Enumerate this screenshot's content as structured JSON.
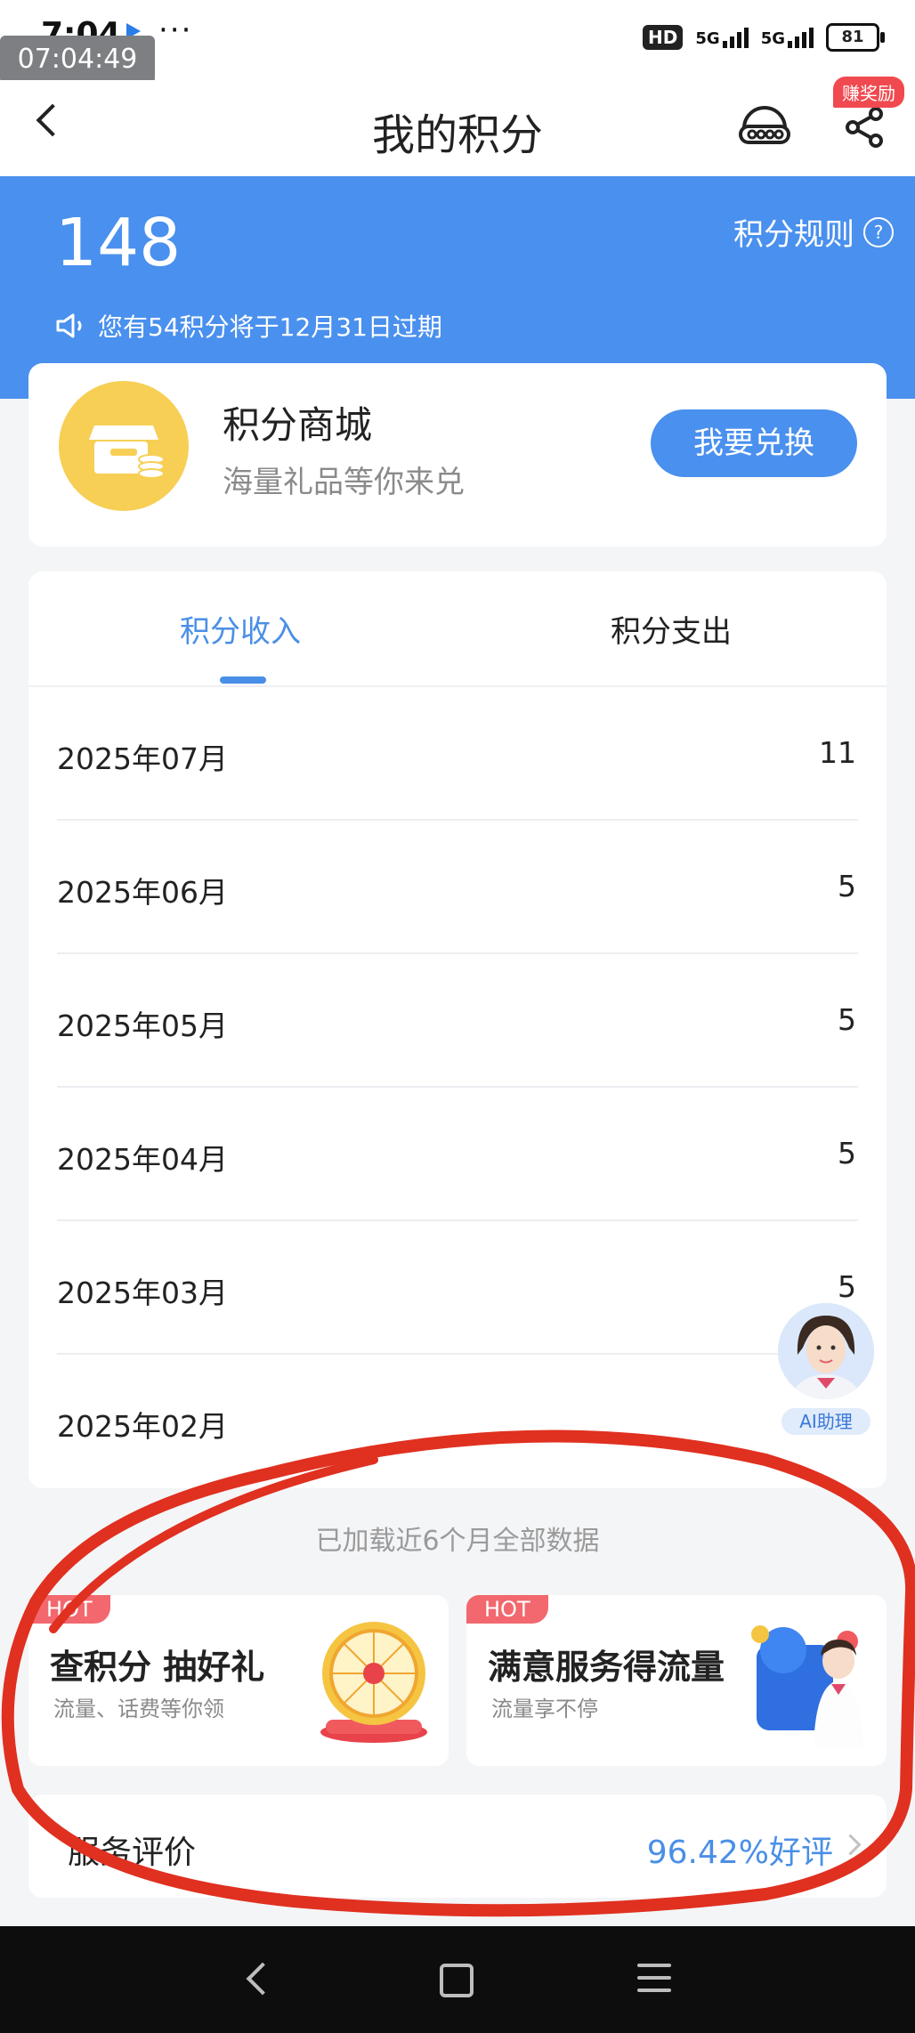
{
  "status_bar": {
    "time": "7:04",
    "dots": "···",
    "clock_badge": "07:04:49",
    "hd": "HD",
    "net1": "5G",
    "net2": "5G",
    "battery": "81"
  },
  "navbar": {
    "title": "我的积分",
    "reward_badge": "赚奖励"
  },
  "hero": {
    "points": "148",
    "rules_label": "积分规则",
    "rules_icon_glyph": "?",
    "expiry_notice": "您有54积分将于12月31日过期"
  },
  "mall": {
    "title": "积分商城",
    "subtitle": "海量礼品等你来兑",
    "button_label": "我要兑换"
  },
  "tabs": {
    "income": "积分收入",
    "expense": "积分支出"
  },
  "records": [
    {
      "month": "2025年07月",
      "value": "11"
    },
    {
      "month": "2025年06月",
      "value": "5"
    },
    {
      "month": "2025年05月",
      "value": "5"
    },
    {
      "month": "2025年04月",
      "value": "5"
    },
    {
      "month": "2025年03月",
      "value": "5"
    },
    {
      "month": "2025年02月",
      "value": ""
    }
  ],
  "assistant": {
    "label": "AI助理"
  },
  "loaded_notice": "已加载近6个月全部数据",
  "promos": [
    {
      "badge": "HOT",
      "title": "查积分  抽好礼",
      "subtitle": "流量、话费等你领"
    },
    {
      "badge": "HOT",
      "title": "满意服务得流量",
      "subtitle": "流量享不停"
    }
  ],
  "evaluation": {
    "label": "服务评价",
    "value": "96.42%好评"
  },
  "colors": {
    "brand_blue": "#4a90ee",
    "hot_red": "#f2686e",
    "mall_yellow": "#f7cf55",
    "annotation_red": "#e03020"
  }
}
